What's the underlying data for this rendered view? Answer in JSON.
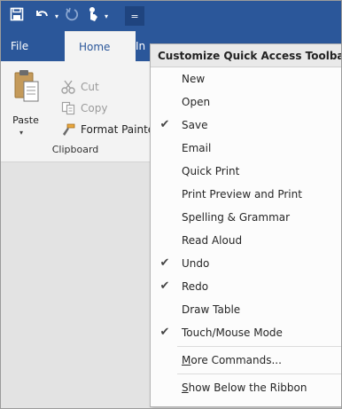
{
  "qat": {
    "dropdown_arrow": "▾",
    "customize_glyph": "="
  },
  "tabs": [
    {
      "label": "File"
    },
    {
      "label": "Home"
    },
    {
      "label": "In"
    }
  ],
  "clipboard": {
    "paste_label": "Paste",
    "paste_arrow": "▾",
    "cut_label": "Cut",
    "copy_label": "Copy",
    "format_painter_label": "Format Painte",
    "group_label": "Clipboard"
  },
  "menu": {
    "title": "Customize Quick Access Toolbar",
    "check_glyph": "✔",
    "items": [
      {
        "label": "New",
        "checked": false
      },
      {
        "label": "Open",
        "checked": false
      },
      {
        "label": "Save",
        "checked": true
      },
      {
        "label": "Email",
        "checked": false
      },
      {
        "label": "Quick Print",
        "checked": false
      },
      {
        "label": "Print Preview and Print",
        "checked": false
      },
      {
        "label": "Spelling & Grammar",
        "checked": false
      },
      {
        "label": "Read Aloud",
        "checked": false
      },
      {
        "label": "Undo",
        "checked": true
      },
      {
        "label": "Redo",
        "checked": true
      },
      {
        "label": "Draw Table",
        "checked": false
      },
      {
        "label": "Touch/Mouse Mode",
        "checked": true
      }
    ],
    "more_commands": {
      "first": "M",
      "rest": "ore Commands..."
    },
    "show_below": {
      "first": "S",
      "rest": "how Below the Ribbon"
    }
  },
  "icons": {
    "save": "save-icon",
    "undo": "undo-icon",
    "redo": "redo-icon",
    "touch": "touch-mode-icon",
    "customize": "customize-qat-icon",
    "paste": "paste-icon",
    "cut": "scissors-icon",
    "copy": "copy-icon",
    "format_painter": "format-painter-icon",
    "check": "checkmark-icon"
  },
  "colors": {
    "title_bar": "#2b579a",
    "ribbon": "#f3f3f3",
    "menu_header": "#e9e9e9"
  }
}
